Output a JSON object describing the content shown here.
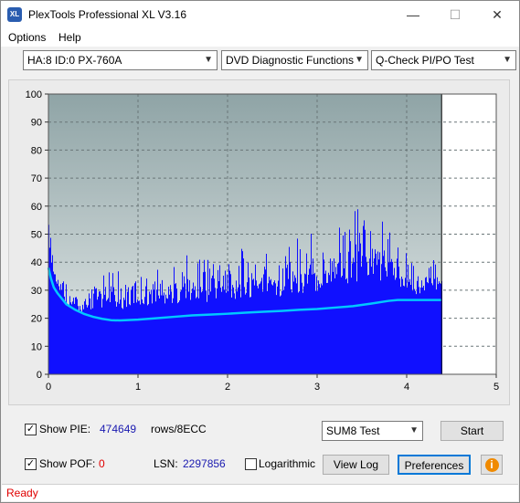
{
  "window": {
    "title": "PlexTools Professional XL V3.16",
    "app_icon": "XL"
  },
  "titlebar_buttons": {
    "minimize": "—",
    "maximize": "☐",
    "close": "✕"
  },
  "menu": {
    "options": "Options",
    "help": "Help"
  },
  "toolbar": {
    "drive": "HA:8 ID:0  PX-760A",
    "function": "DVD Diagnostic Functions",
    "test": "Q-Check PI/PO Test"
  },
  "chart_data": {
    "type": "bar",
    "x_ticks": [
      "0",
      "1",
      "2",
      "3",
      "4",
      "5"
    ],
    "y_ticks": [
      "0",
      "10",
      "20",
      "30",
      "40",
      "50",
      "60",
      "70",
      "80",
      "90",
      "100"
    ],
    "xlim": [
      0,
      5
    ],
    "ylim": [
      0,
      100
    ],
    "grid": true,
    "end_marker": 4.39,
    "pie_envelope": {
      "x": [
        0.0,
        0.03,
        0.1,
        0.2,
        0.3,
        0.4,
        0.5,
        0.6,
        0.7,
        0.8,
        1.0,
        1.2,
        1.4,
        1.6,
        1.8,
        2.0,
        2.2,
        2.4,
        2.6,
        2.8,
        3.0,
        3.1,
        3.2,
        3.3,
        3.4,
        3.5,
        3.6,
        3.7,
        3.8,
        3.9,
        4.0,
        4.1,
        4.2,
        4.3,
        4.39
      ],
      "y": [
        55,
        47,
        38,
        32,
        27,
        28,
        32,
        34,
        36,
        33,
        35,
        37,
        38,
        40,
        40,
        41,
        42,
        44,
        45,
        47,
        48,
        50,
        53,
        55,
        56,
        58,
        60,
        55,
        50,
        47,
        44,
        36,
        37,
        40,
        48
      ]
    },
    "series": [
      {
        "name": "",
        "color": "#1010ff",
        "x": [
          0.0,
          0.05,
          0.1,
          0.15,
          0.2,
          0.3,
          0.4,
          0.5,
          0.6,
          0.7,
          0.8,
          0.9,
          1.0,
          1.2,
          1.4,
          1.6,
          1.8,
          2.0,
          2.2,
          2.4,
          2.6,
          2.8,
          3.0,
          3.2,
          3.4,
          3.6,
          3.8,
          4.0,
          4.2,
          4.39
        ],
        "y": [
          40,
          33,
          28,
          25,
          22,
          21,
          20,
          20,
          20,
          20,
          20,
          20,
          20,
          21,
          21,
          21,
          21,
          21,
          22,
          22,
          22,
          22,
          23,
          24,
          24,
          25,
          26,
          26,
          26,
          26
        ]
      },
      {
        "name": "",
        "color": "#00c8ff",
        "x": [
          0.0,
          0.03,
          0.06,
          0.1,
          0.15,
          0.2,
          0.3,
          0.4,
          0.5,
          0.6,
          0.7,
          0.8,
          1.0,
          1.2,
          1.4,
          1.6,
          1.8,
          2.0,
          2.2,
          2.4,
          2.6,
          2.8,
          3.0,
          3.2,
          3.4,
          3.6,
          3.8,
          3.9,
          4.0,
          4.2,
          4.39
        ],
        "y": [
          38,
          34,
          31,
          29,
          27,
          25,
          23,
          21.5,
          20.5,
          19.8,
          19.3,
          19.2,
          19.5,
          20,
          20.5,
          21,
          21.3,
          21.6,
          22,
          22.3,
          22.6,
          23,
          23.3,
          23.8,
          24.3,
          25.2,
          26.2,
          26.5,
          26.5,
          26.5,
          26.5
        ]
      }
    ]
  },
  "controls": {
    "show_pie_label": "Show PIE:",
    "show_pie_value": "474649",
    "show_pie_unit": "rows/8ECC",
    "show_pof_label": "Show POF:",
    "show_pof_value": "0",
    "lsn_label": "LSN:",
    "lsn_value": "2297856",
    "logarithmic_label": "Logarithmic",
    "sum8_select": "SUM8 Test",
    "start_button": "Start",
    "view_log_button": "View Log",
    "preferences_button": "Preferences",
    "info_icon": "i",
    "check_mark": "✓"
  },
  "status": {
    "text": "Ready"
  },
  "colors": {
    "accent": "#0000ff",
    "pie_value": "#1a1ab0",
    "pof_value": "#e00000",
    "status_text": "#e00000",
    "cyan": "#00c8ff"
  }
}
